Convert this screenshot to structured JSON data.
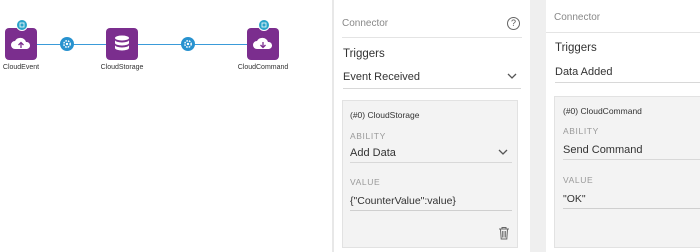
{
  "flow": {
    "nodes": [
      {
        "label": "CloudEvent",
        "icon": "cloud-upload-icon"
      },
      {
        "label": "CloudStorage",
        "icon": "database-icon"
      },
      {
        "label": "CloudCommand",
        "icon": "cloud-download-icon"
      }
    ],
    "connector_icon": "gear-icon",
    "node_color": "#7b2e8e",
    "wire_color": "#3a9bd9"
  },
  "panel1": {
    "header": "Connector",
    "help": "?",
    "triggers_label": "Triggers",
    "trigger_value": "Event Received",
    "card": {
      "title": "(#0) CloudStorage",
      "ability_label": "ABILITY",
      "ability_value": "Add Data",
      "value_label": "VALUE",
      "value_value": "{\"CounterValue\":value}"
    }
  },
  "panel2": {
    "header": "Connector",
    "triggers_label": "Triggers",
    "trigger_value": "Data Added",
    "card": {
      "title": "(#0) CloudCommand",
      "ability_label": "ABILITY",
      "ability_value": "Send Command",
      "value_label": "VALUE",
      "value_value": "\"OK\""
    }
  }
}
